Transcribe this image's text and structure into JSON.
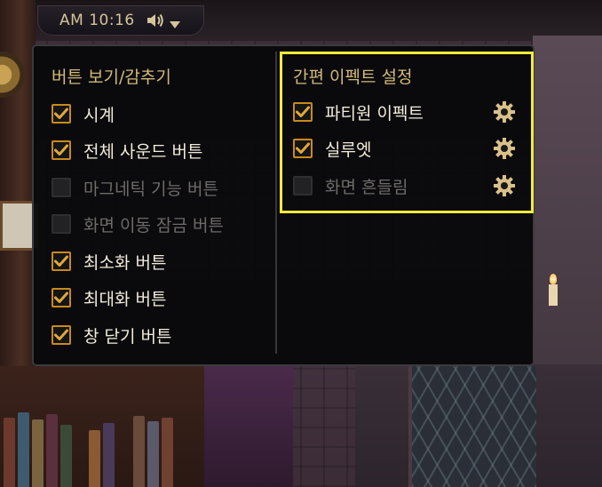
{
  "clock": {
    "time": "AM 10:16",
    "speaker_icon": "speaker-icon",
    "dropdown_icon": "triangle-down-icon"
  },
  "left_section": {
    "title": "버튼 보기/감추기",
    "items": [
      {
        "label": "시계",
        "checked": true
      },
      {
        "label": "전체 사운드 버튼",
        "checked": true
      },
      {
        "label": "마그네틱 기능 버튼",
        "checked": false
      },
      {
        "label": "화면 이동 잠금 버튼",
        "checked": false
      },
      {
        "label": "최소화 버튼",
        "checked": true
      },
      {
        "label": "최대화 버튼",
        "checked": true
      },
      {
        "label": "창 닫기 버튼",
        "checked": true
      }
    ]
  },
  "right_section": {
    "title": "간편 이펙트 설정",
    "items": [
      {
        "label": "파티원 이펙트",
        "checked": true,
        "settings_icon": "gear-icon"
      },
      {
        "label": "실루엣",
        "checked": true,
        "settings_icon": "gear-icon"
      },
      {
        "label": "화면 흔들림",
        "checked": false,
        "settings_icon": "gear-icon"
      }
    ]
  },
  "colors": {
    "accent_check": "#e0a83a",
    "highlight_box": "#f4ea3a",
    "title_text": "#d3b97a"
  }
}
